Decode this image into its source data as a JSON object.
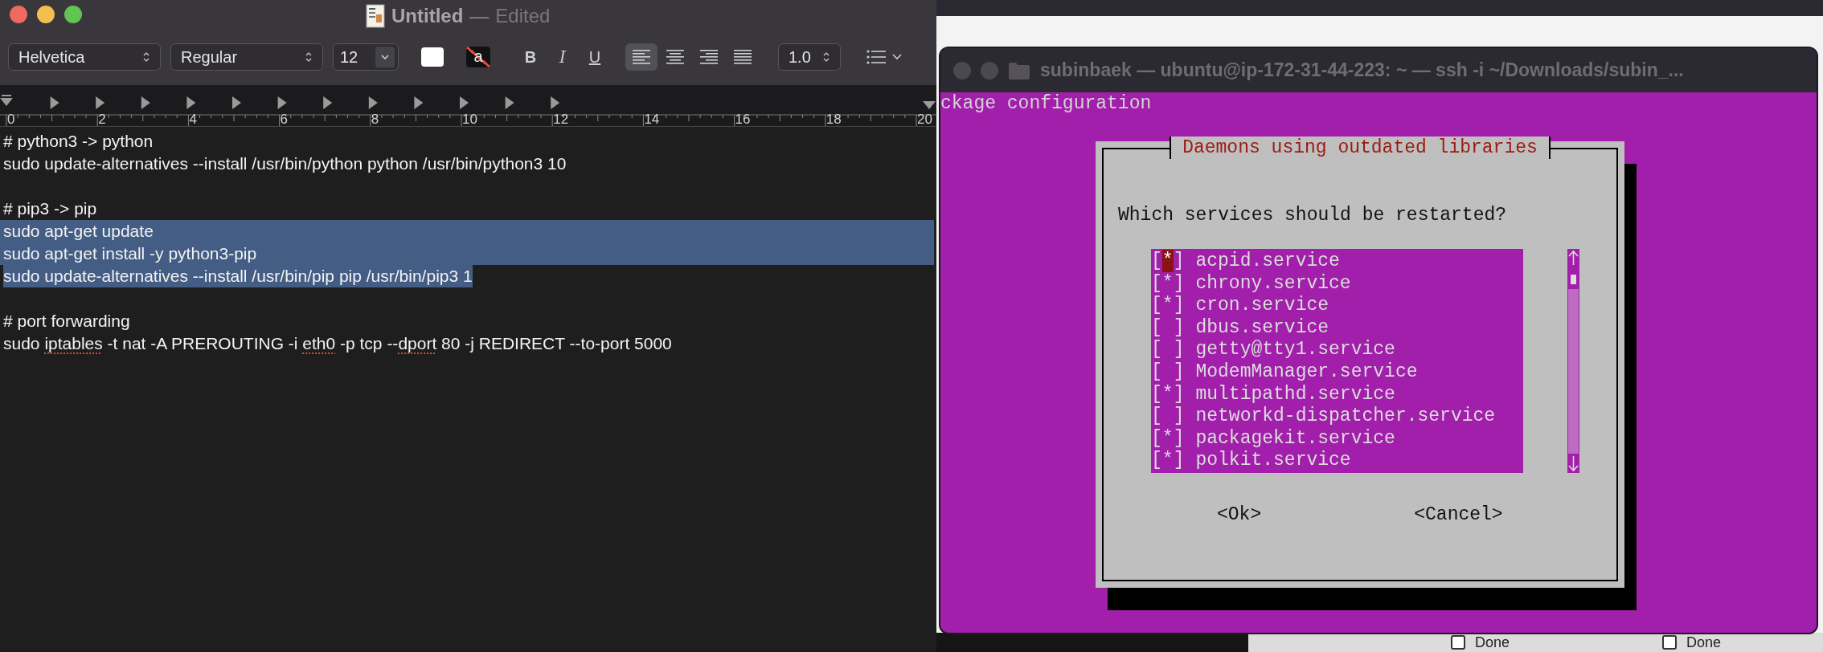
{
  "textedit": {
    "title": "Untitled",
    "title_separator": "—",
    "status": "Edited",
    "font_family": "Helvetica",
    "font_style": "Regular",
    "font_size": "12",
    "style_buttons": [
      "B",
      "I",
      "U"
    ],
    "highlight_swatch": "a",
    "alignments": [
      {
        "kind": "left",
        "selected": true
      },
      {
        "kind": "center",
        "selected": false
      },
      {
        "kind": "right",
        "selected": false
      },
      {
        "kind": "justify",
        "selected": false
      }
    ],
    "line_spacing": "1.0",
    "ruler_labels": [
      "0",
      "2",
      "4",
      "6",
      "8",
      "10",
      "12",
      "14",
      "16",
      "18",
      "20"
    ],
    "lines": [
      {
        "kind": "text",
        "selected": false,
        "segments": [
          {
            "text": "# python3 -> python",
            "misspelled": false
          }
        ]
      },
      {
        "kind": "text",
        "selected": false,
        "segments": [
          {
            "text": "sudo update-alternatives --install /usr/bin/python python /usr/bin/python3 10",
            "misspelled": false
          }
        ]
      },
      {
        "kind": "blank"
      },
      {
        "kind": "text",
        "selected": false,
        "segments": [
          {
            "text": "# pip3 -> pip",
            "misspelled": false
          }
        ]
      },
      {
        "kind": "text",
        "selected": true,
        "segments": [
          {
            "text": "sudo apt-get update",
            "misspelled": false
          }
        ]
      },
      {
        "kind": "text",
        "selected": true,
        "segments": [
          {
            "text": "sudo apt-get install -y python3-pip",
            "misspelled": false
          }
        ]
      },
      {
        "kind": "text",
        "selected": true,
        "segments": [
          {
            "text": "sudo update-alternatives --install /usr/bin/pip pip /usr/bin/pip3 1",
            "misspelled": false
          }
        ]
      },
      {
        "kind": "blank"
      },
      {
        "kind": "text",
        "selected": false,
        "segments": [
          {
            "text": "# port forwarding",
            "misspelled": false
          }
        ]
      },
      {
        "kind": "text",
        "selected": false,
        "segments": [
          {
            "text": "sudo ",
            "misspelled": false
          },
          {
            "text": "iptables",
            "misspelled": true
          },
          {
            "text": " -t nat -A PREROUTING -i ",
            "misspelled": false
          },
          {
            "text": "eth0",
            "misspelled": true
          },
          {
            "text": " -p tcp --",
            "misspelled": false
          },
          {
            "text": "dport",
            "misspelled": true
          },
          {
            "text": " 80 -j REDIRECT --to-port 5000",
            "misspelled": false
          }
        ]
      }
    ]
  },
  "terminal": {
    "title": "subinbaek — ubuntu@ip-172-31-44-223: ~ — ssh -i ~/Downloads/subin_...",
    "header": "ckage configuration",
    "dialog": {
      "title": "Daemons using outdated libraries",
      "prompt": "Which services should be restarted?",
      "items": [
        {
          "mark": "[*]",
          "label": "acpid.service",
          "cursor": true
        },
        {
          "mark": "[*]",
          "label": "chrony.service",
          "cursor": false
        },
        {
          "mark": "[*]",
          "label": "cron.service",
          "cursor": false
        },
        {
          "mark": "[ ]",
          "label": "dbus.service",
          "cursor": false
        },
        {
          "mark": "[ ]",
          "label": "getty@tty1.service",
          "cursor": false
        },
        {
          "mark": "[ ]",
          "label": "ModemManager.service",
          "cursor": false
        },
        {
          "mark": "[*]",
          "label": "multipathd.service",
          "cursor": false
        },
        {
          "mark": "[ ]",
          "label": "networkd-dispatcher.service",
          "cursor": false
        },
        {
          "mark": "[*]",
          "label": "packagekit.service",
          "cursor": false
        },
        {
          "mark": "[*]",
          "label": "polkit.service",
          "cursor": false
        }
      ],
      "buttons": [
        "<Ok>",
        "<Cancel>"
      ]
    }
  },
  "background": {
    "checkboxes": [
      {
        "label": "Done",
        "checked": false
      },
      {
        "label": "Done",
        "checked": false
      }
    ]
  }
}
